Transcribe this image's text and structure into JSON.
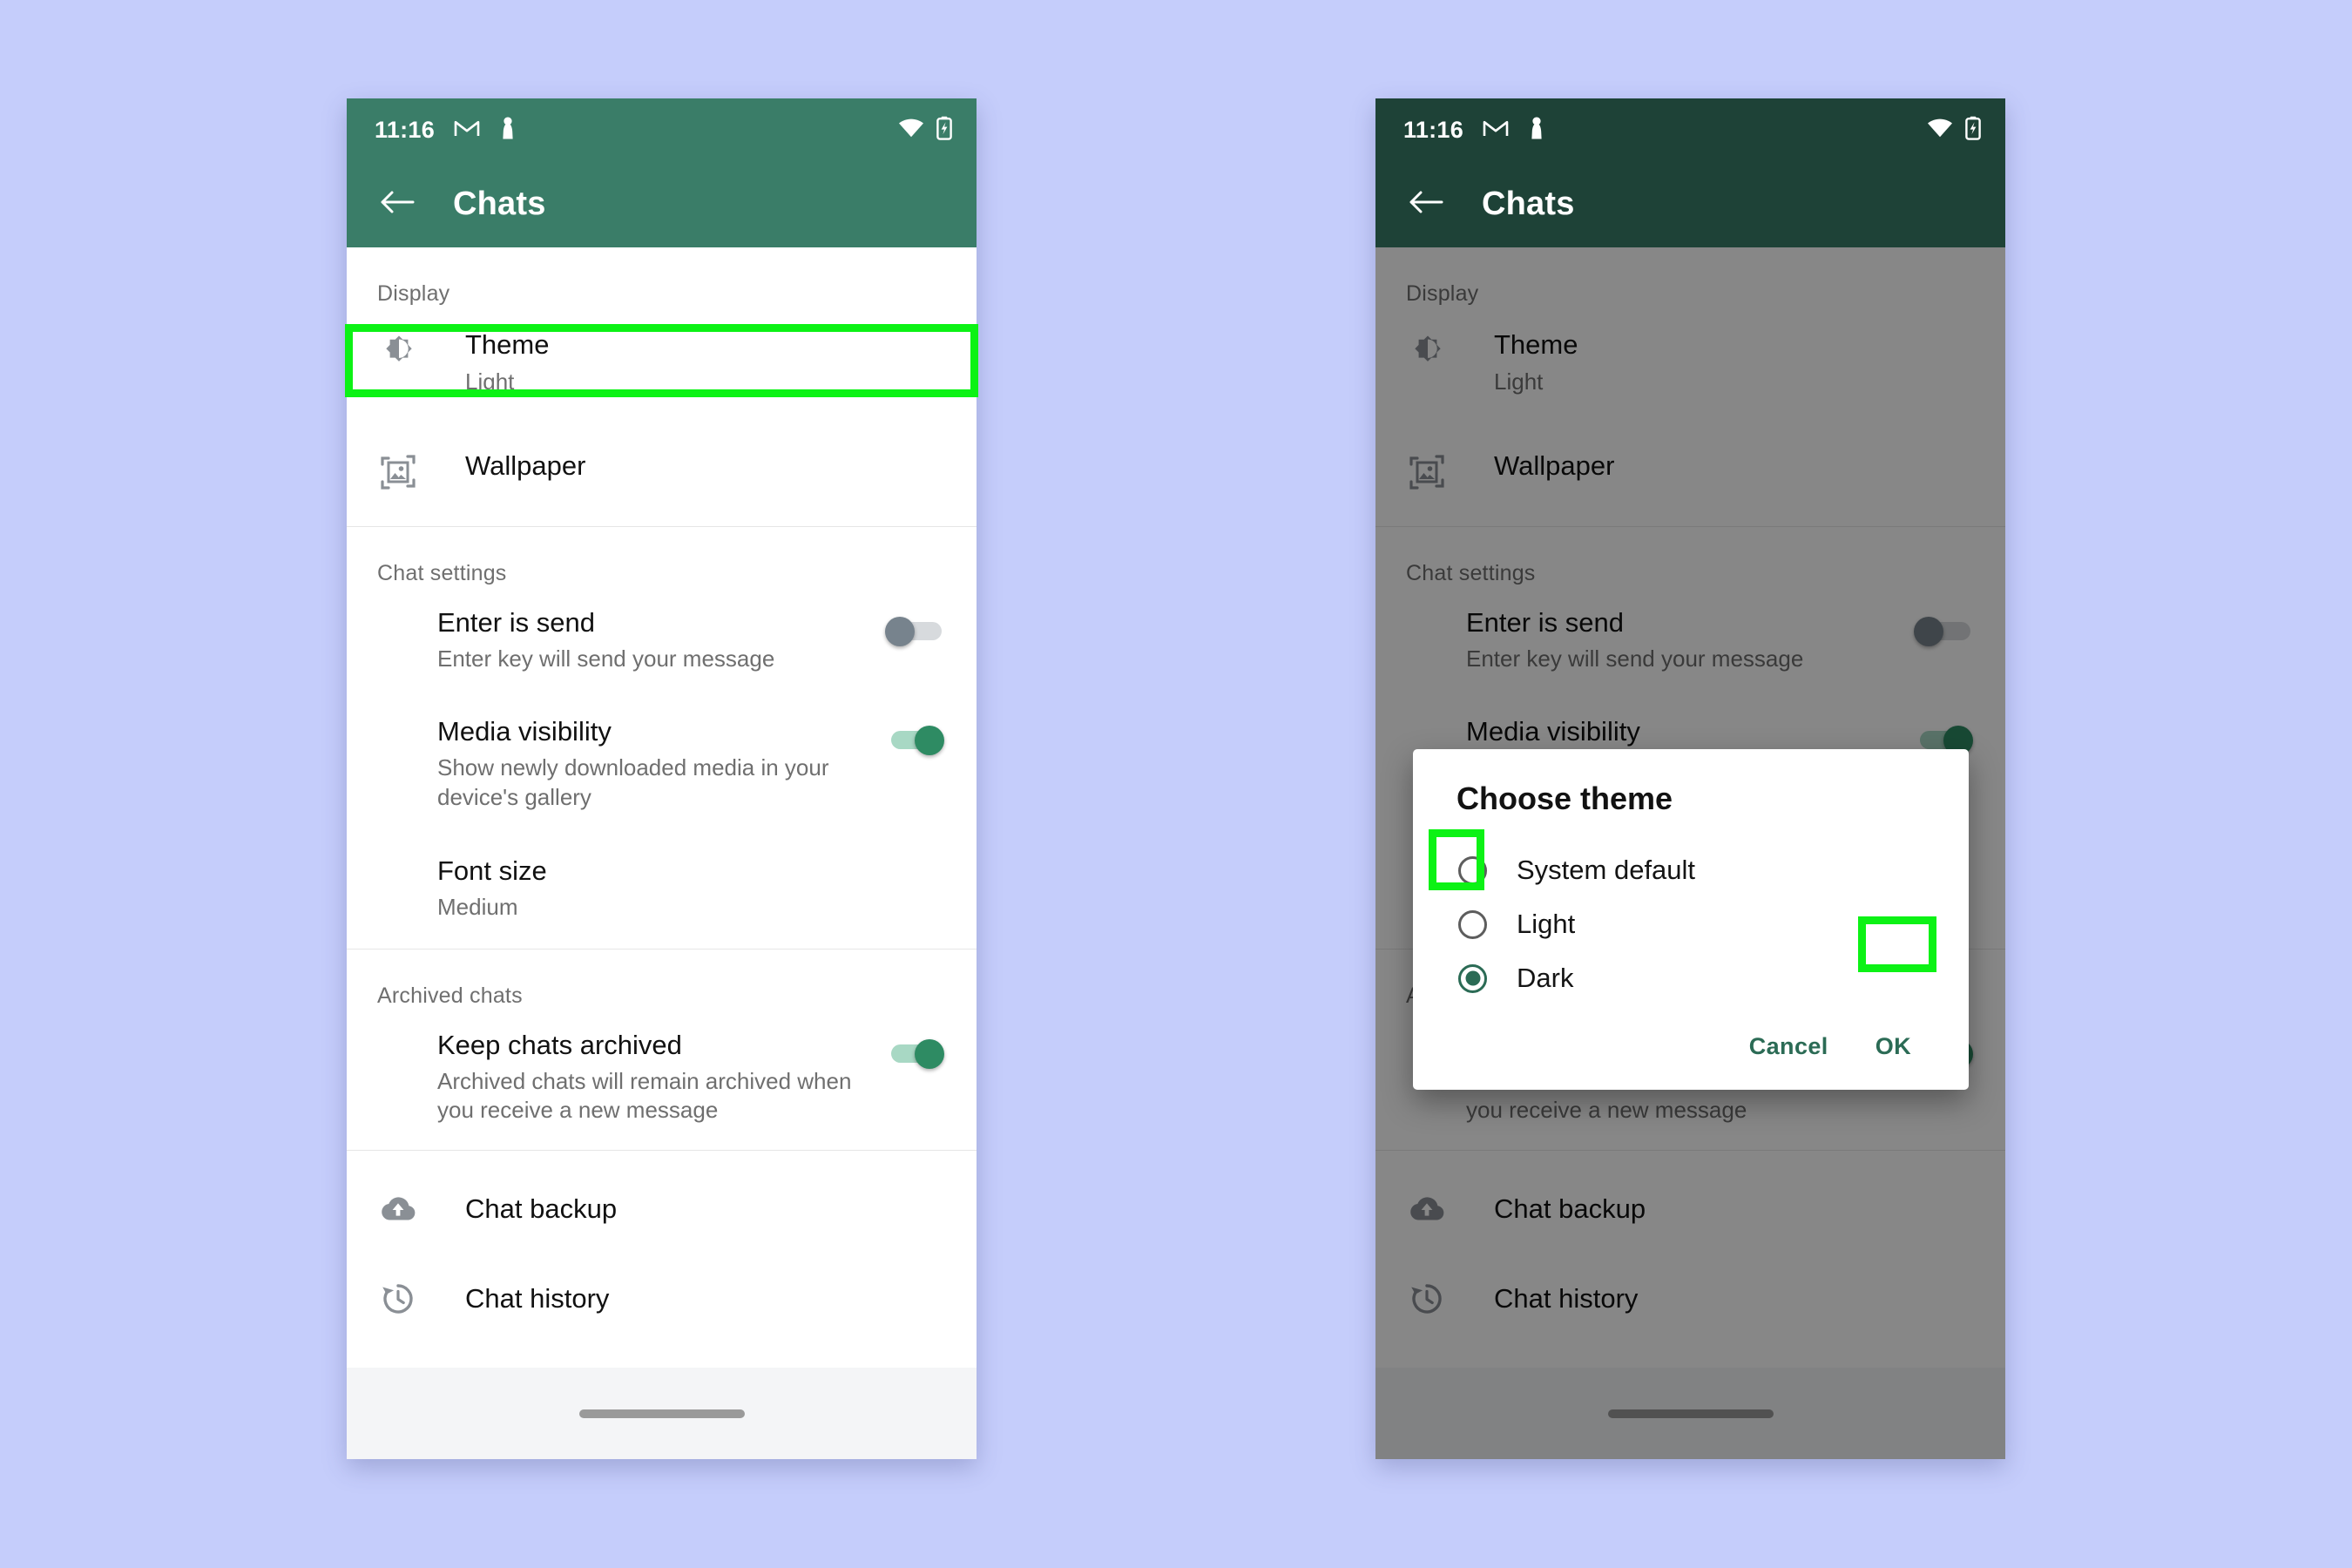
{
  "page": {
    "background_color": "#c5cdfb",
    "accent_green": "#3a7d68",
    "highlight_color": "#0cf215"
  },
  "status_bar": {
    "time": "11:16",
    "icons_left": [
      "gmail-icon",
      "pawn-icon"
    ],
    "icons_right": [
      "wifi-icon",
      "battery-charging-icon"
    ]
  },
  "app_bar": {
    "back_label": "Back",
    "title": "Chats"
  },
  "sections": {
    "display": {
      "header": "Display",
      "items": [
        {
          "icon": "brightness-icon",
          "title": "Theme",
          "subtitle": "Light"
        },
        {
          "icon": "wallpaper-icon",
          "title": "Wallpaper",
          "subtitle": ""
        }
      ]
    },
    "chat_settings": {
      "header": "Chat settings",
      "items": [
        {
          "title": "Enter is send",
          "subtitle": "Enter key will send your message",
          "toggle": "off"
        },
        {
          "title": "Media visibility",
          "subtitle": "Show newly downloaded media in your device's gallery",
          "toggle": "on"
        },
        {
          "title": "Font size",
          "subtitle": "Medium",
          "toggle": "none"
        }
      ]
    },
    "archived_chats": {
      "header": "Archived chats",
      "items": [
        {
          "title": "Keep chats archived",
          "subtitle": "Archived chats will remain archived when you receive a new message",
          "toggle": "on"
        }
      ]
    },
    "bottom": {
      "items": [
        {
          "icon": "cloud-upload-icon",
          "title": "Chat backup"
        },
        {
          "icon": "history-icon",
          "title": "Chat history"
        }
      ]
    }
  },
  "dialog": {
    "title": "Choose theme",
    "options": [
      {
        "label": "System default",
        "selected": false
      },
      {
        "label": "Light",
        "selected": false
      },
      {
        "label": "Dark",
        "selected": true
      }
    ],
    "cancel_label": "Cancel",
    "ok_label": "OK"
  },
  "annotations": [
    {
      "name": "theme-row-highlight",
      "target": "Theme"
    },
    {
      "name": "dark-radio-highlight",
      "target": "Dark"
    },
    {
      "name": "ok-button-highlight",
      "target": "OK"
    }
  ]
}
